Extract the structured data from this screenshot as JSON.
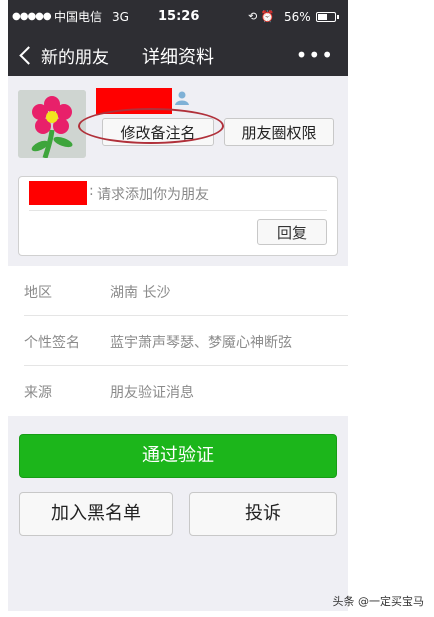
{
  "status_bar": {
    "signal": "●●●●●",
    "carrier": "中国电信",
    "network": "3G",
    "time": "15:26",
    "icons": "⟲ ⏰",
    "battery": "56%",
    "battery_level": 0.56
  },
  "nav": {
    "back_label": "新的朋友",
    "title": "详细资料",
    "more_label": "•••"
  },
  "profile": {
    "remark_button": "修改备注名",
    "moments_permission_button": "朋友圈权限"
  },
  "verification": {
    "colon": ":",
    "message": "请求添加你为朋友",
    "reply_button": "回复"
  },
  "details": {
    "rows": [
      {
        "label": "地区",
        "value": "湖南 长沙"
      },
      {
        "label": "个性签名",
        "value": "蓝宇萧声琴瑟、梦魇心神断弦"
      },
      {
        "label": "来源",
        "value": "朋友验证消息"
      }
    ]
  },
  "actions": {
    "approve": "通过验证",
    "blacklist": "加入黑名单",
    "complain": "投诉"
  },
  "watermark": "头条 @一定买宝马",
  "colors": {
    "nav_bg": "#2e2e33",
    "approve_green": "#1cb61b",
    "redaction_red": "#ff0000",
    "annotation_ellipse": "#b0303a"
  }
}
